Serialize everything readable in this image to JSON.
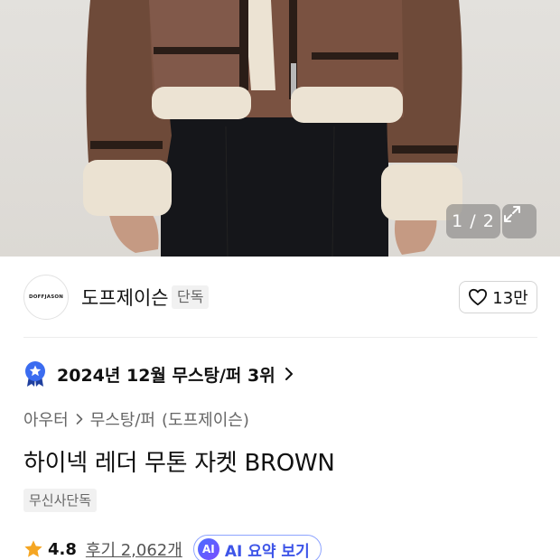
{
  "gallery": {
    "counter": "1 / 2",
    "image_alt": "brown shearling jacket product photo"
  },
  "brand": {
    "logo_text": "DOFFJASON",
    "name": "도프제이슨",
    "exclusive_badge": "단독",
    "like_count": "13만"
  },
  "ranking": {
    "text": "2024년 12월 무스탕/퍼 3위"
  },
  "breadcrumb": {
    "category": "아우터",
    "subcategory": "무스탕/퍼",
    "brand": "(도프제이슨)"
  },
  "product": {
    "title": "하이넥 레더 무톤 자켓 BROWN",
    "tag": "무신사단독"
  },
  "rating": {
    "score": "4.8",
    "reviews": "후기 2,062개",
    "ai_badge": "AI",
    "ai_label": "AI 요약 보기"
  },
  "colors": {
    "accent": "#3e55e8",
    "star": "#f5a623",
    "rank_badge": "#3b6cf0"
  }
}
